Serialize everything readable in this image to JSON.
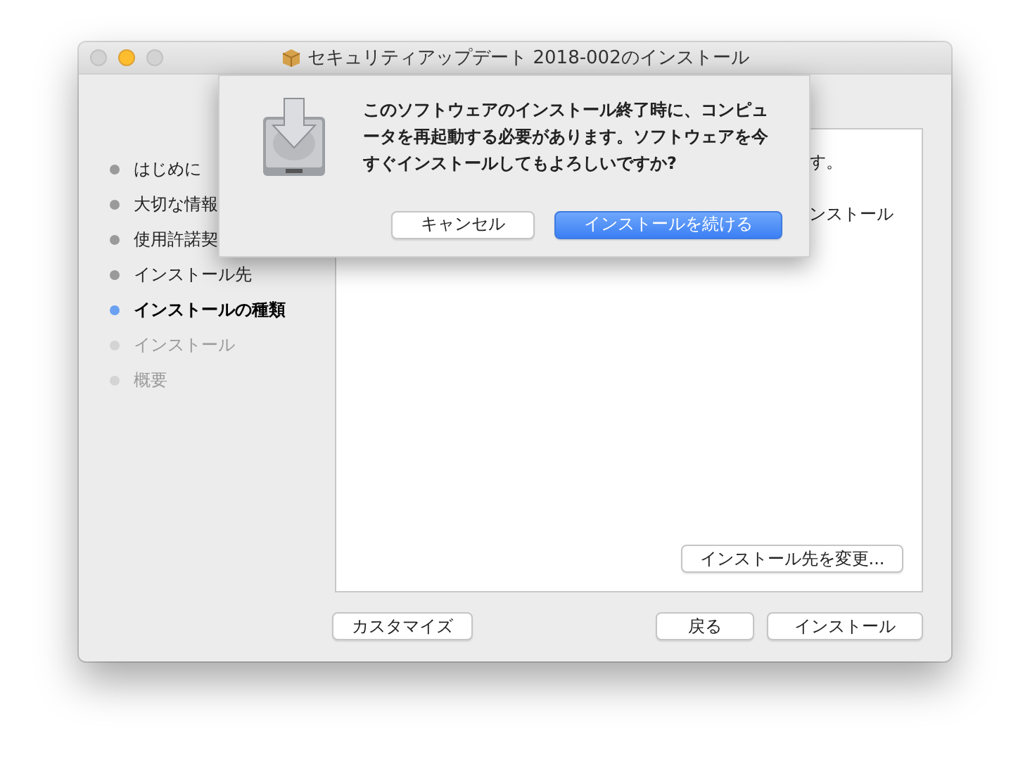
{
  "window": {
    "title": "セキュリティアップデート 2018-002のインストール"
  },
  "sidebar": {
    "items": [
      {
        "label": "はじめに",
        "selected": false,
        "disabled": false
      },
      {
        "label": "大切な情報",
        "selected": false,
        "disabled": false
      },
      {
        "label": "使用許諾契",
        "selected": false,
        "disabled": false
      },
      {
        "label": "インストール先",
        "selected": false,
        "disabled": false
      },
      {
        "label": "インストールの種類",
        "selected": true,
        "disabled": false
      },
      {
        "label": "インストール",
        "selected": false,
        "disabled": true
      },
      {
        "label": "概要",
        "selected": false,
        "disabled": true
      }
    ]
  },
  "content": {
    "texts": [
      "す。",
      "ンストール"
    ],
    "change_location_button": "インストール先を変更..."
  },
  "footer": {
    "customize_button": "カスタマイズ",
    "back_button": "戻る",
    "install_button": "インストール"
  },
  "sheet": {
    "message": "このソフトウェアのインストール終了時に、コンピュータを再起動する必要があります。ソフトウェアを今すぐインストールしてもよろしいですか?",
    "buttons": [
      {
        "label": "キャンセル",
        "kind": "normal"
      },
      {
        "label": "インストールを続ける",
        "kind": "default"
      }
    ]
  }
}
